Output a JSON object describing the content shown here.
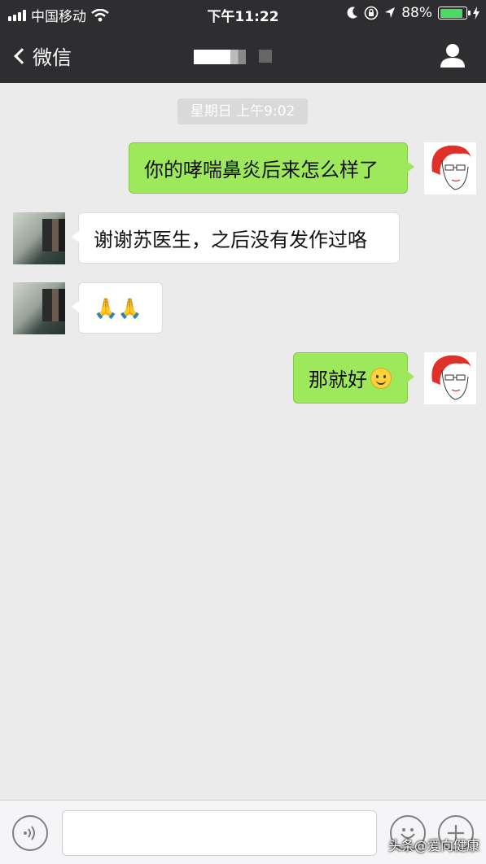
{
  "status_bar": {
    "carrier": "中国移动",
    "time": "下午11:22",
    "battery_percent": "88%",
    "battery_level": 0.88,
    "icons": [
      "signal-icon",
      "wifi-icon",
      "moon-icon",
      "rotation-lock-icon",
      "location-icon",
      "battery-icon",
      "charging-icon"
    ]
  },
  "nav": {
    "back_label": "微信",
    "title": "",
    "profile_icon": "person-icon"
  },
  "chat": {
    "timestamp": "星期日 上午9:02",
    "messages": [
      {
        "sender": "me",
        "text": "你的哮喘鼻炎后来怎么样了"
      },
      {
        "sender": "other",
        "text": "谢谢苏医生，之后没有发作过咯"
      },
      {
        "sender": "other",
        "text": "🙏🙏"
      },
      {
        "sender": "me",
        "text": "那就好",
        "emoji": "smile-emoji"
      }
    ]
  },
  "input_bar": {
    "voice_icon": "voice-icon",
    "emoji_icon": "emoji-icon",
    "plus_icon": "plus-icon",
    "input_value": ""
  },
  "watermark": "头条@爱向健康",
  "colors": {
    "header_bg": "#2e2e30",
    "chat_bg": "#ebebeb",
    "my_bubble": "#9ee85b",
    "other_bubble": "#ffffff",
    "battery": "#4cd964"
  }
}
